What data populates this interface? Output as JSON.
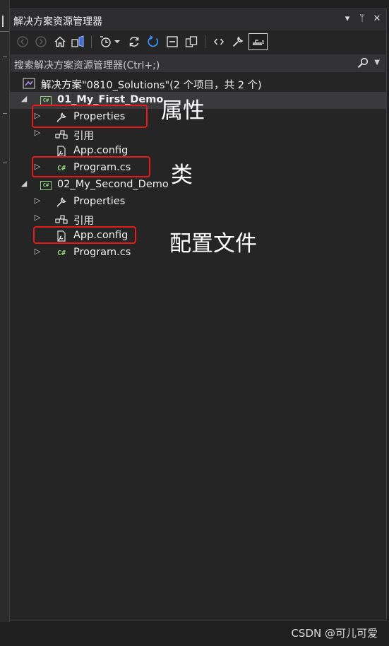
{
  "window": {
    "title": "解决方案资源管理器",
    "title_buttons": [
      "▾",
      "ᛘ",
      "✕"
    ]
  },
  "search": {
    "placeholder": "搜索解决方案资源管理器(Ctrl+;)"
  },
  "tree": {
    "solution": {
      "label": "解决方案\"0810_Solutions\"(2 个项目，共 2 个)"
    },
    "project1": {
      "label": "01_My_First_Demo",
      "items": [
        {
          "label": "Properties",
          "icon": "wrench-icon"
        },
        {
          "label": "引用",
          "icon": "references-icon"
        },
        {
          "label": "App.config",
          "icon": "config-file-icon"
        },
        {
          "label": "Program.cs",
          "icon": "csharp-file-icon"
        }
      ]
    },
    "project2": {
      "label": "02_My_Second_Demo",
      "items": [
        {
          "label": "Properties",
          "icon": "wrench-icon"
        },
        {
          "label": "引用",
          "icon": "references-icon"
        },
        {
          "label": "App.config",
          "icon": "config-file-icon"
        },
        {
          "label": "Program.cs",
          "icon": "csharp-file-icon"
        }
      ]
    }
  },
  "annotations": {
    "properties": "属性",
    "class": "类",
    "config": "配置文件"
  },
  "watermark": "CSDN @可儿可爱",
  "colors": {
    "panel": "#252526",
    "highlight": "#e8191b",
    "csharp": "#8bd17c",
    "accent": "#3794ff"
  }
}
